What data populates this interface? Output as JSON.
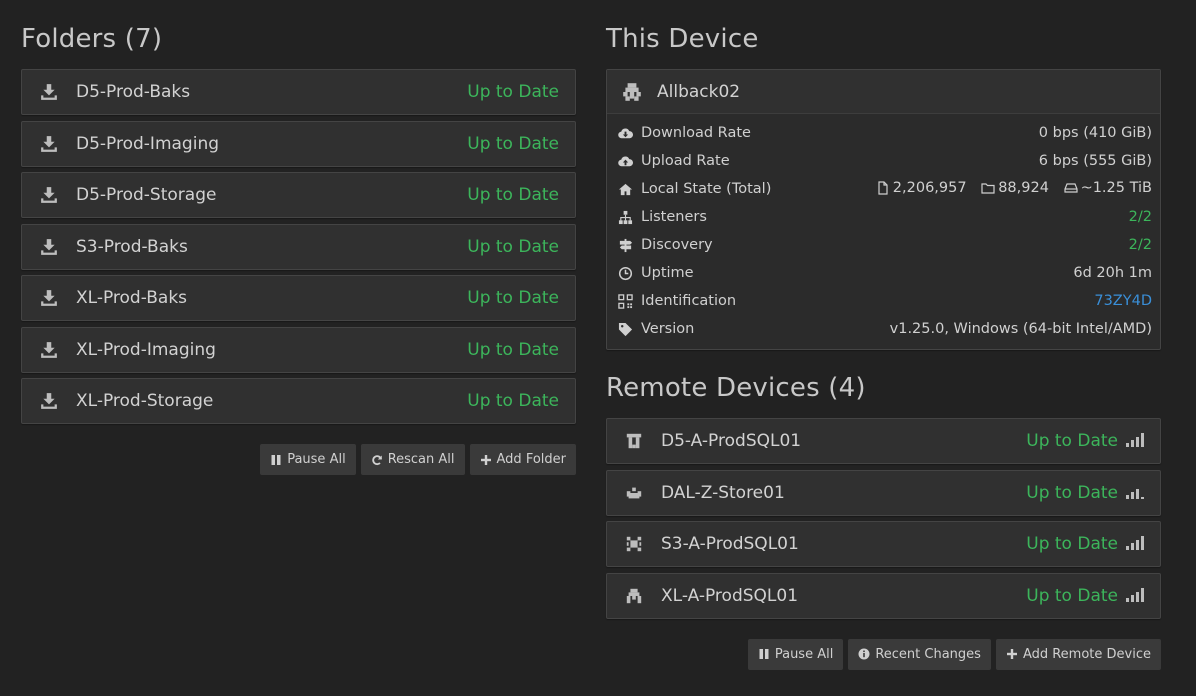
{
  "folders": {
    "title": "Folders (7)",
    "items": [
      {
        "name": "D5-Prod-Baks",
        "status": "Up to Date"
      },
      {
        "name": "D5-Prod-Imaging",
        "status": "Up to Date"
      },
      {
        "name": "D5-Prod-Storage",
        "status": "Up to Date"
      },
      {
        "name": "S3-Prod-Baks",
        "status": "Up to Date"
      },
      {
        "name": "XL-Prod-Baks",
        "status": "Up to Date"
      },
      {
        "name": "XL-Prod-Imaging",
        "status": "Up to Date"
      },
      {
        "name": "XL-Prod-Storage",
        "status": "Up to Date"
      }
    ],
    "buttons": {
      "pause_all": "Pause All",
      "rescan_all": "Rescan All",
      "add_folder": "Add Folder"
    }
  },
  "this_device": {
    "title": "This Device",
    "name": "Allback02",
    "rows": {
      "download": {
        "label": "Download Rate",
        "value": "0 bps (410 GiB)"
      },
      "upload": {
        "label": "Upload Rate",
        "value": "6 bps (555 GiB)"
      },
      "local_state": {
        "label": "Local State (Total)",
        "files": "2,206,957",
        "dirs": "88,924",
        "size": "~1.25 TiB"
      },
      "listeners": {
        "label": "Listeners",
        "value": "2/2"
      },
      "discovery": {
        "label": "Discovery",
        "value": "2/2"
      },
      "uptime": {
        "label": "Uptime",
        "value": "6d 20h 1m"
      },
      "identification": {
        "label": "Identification",
        "value": "73ZY4D"
      },
      "version": {
        "label": "Version",
        "value": "v1.25.0, Windows (64-bit Intel/AMD)"
      }
    }
  },
  "remote_devices": {
    "title": "Remote Devices (4)",
    "items": [
      {
        "name": "D5-A-ProdSQL01",
        "status": "Up to Date"
      },
      {
        "name": "DAL-Z-Store01",
        "status": "Up to Date"
      },
      {
        "name": "S3-A-ProdSQL01",
        "status": "Up to Date"
      },
      {
        "name": "XL-A-ProdSQL01",
        "status": "Up to Date"
      }
    ],
    "buttons": {
      "pause_all": "Pause All",
      "recent_changes": "Recent Changes",
      "add_remote": "Add Remote Device"
    }
  },
  "colors": {
    "background": "#222222",
    "panel": "#303030",
    "status_green": "#3cb55b",
    "id_blue": "#3a8fd8"
  }
}
